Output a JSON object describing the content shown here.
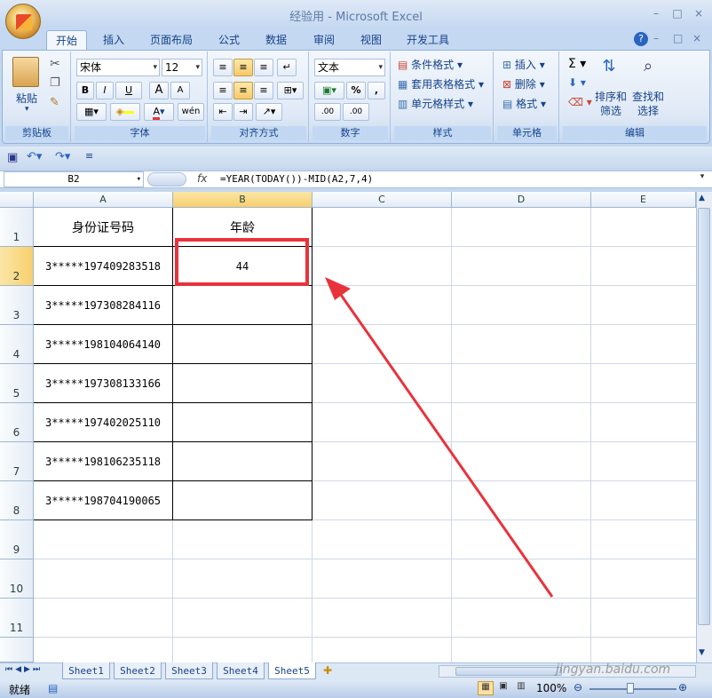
{
  "window": {
    "title": "经验用 - Microsoft Excel"
  },
  "tabs": [
    "开始",
    "插入",
    "页面布局",
    "公式",
    "数据",
    "审阅",
    "视图",
    "开发工具"
  ],
  "ribbon": {
    "clipboard": {
      "label": "剪贴板",
      "paste": "粘贴"
    },
    "font": {
      "label": "字体",
      "name": "宋体",
      "size": "12",
      "bold": "B",
      "italic": "I",
      "underline": "U",
      "grow": "A",
      "shrink": "A",
      "wen": "wén"
    },
    "alignment": {
      "label": "对齐方式"
    },
    "number": {
      "label": "数字",
      "format": "文本",
      "percent": "%",
      "comma": ",",
      "inc": ".00",
      "dec": ".00"
    },
    "styles": {
      "label": "样式",
      "cond": "条件格式",
      "table": "套用表格格式",
      "cell": "单元格样式"
    },
    "cells": {
      "label": "单元格",
      "insert": "插入",
      "delete": "删除",
      "format": "格式"
    },
    "editing": {
      "label": "编辑",
      "sum": "Σ",
      "sort1": "排序和",
      "sort2": "筛选",
      "find1": "查找和",
      "find2": "选择"
    }
  },
  "formula_bar": {
    "name_box": "B2",
    "fx": "fx",
    "formula": "=YEAR(TODAY())-MID(A2,7,4)"
  },
  "columns": [
    "A",
    "B",
    "C",
    "D",
    "E"
  ],
  "rows": [
    "1",
    "2",
    "3",
    "4",
    "5",
    "6",
    "7",
    "8",
    "9",
    "10",
    "11"
  ],
  "sheet": {
    "header": {
      "a": "身份证号码",
      "b": "年龄"
    },
    "ids": [
      "3*****197409283518",
      "3*****197308284116",
      "3*****198104064140",
      "3*****197308133166",
      "3*****197402025110",
      "3*****198106235118",
      "3*****198704190065"
    ],
    "b2": "44"
  },
  "sheet_tabs": [
    "Sheet1",
    "Sheet2",
    "Sheet3",
    "Sheet4",
    "Sheet5"
  ],
  "status": {
    "ready": "就绪",
    "zoom": "100%"
  },
  "watermark": "jingyan.baidu.com",
  "colors": {
    "accent": "#e8333c",
    "ribbon": "#dfe9f6"
  }
}
